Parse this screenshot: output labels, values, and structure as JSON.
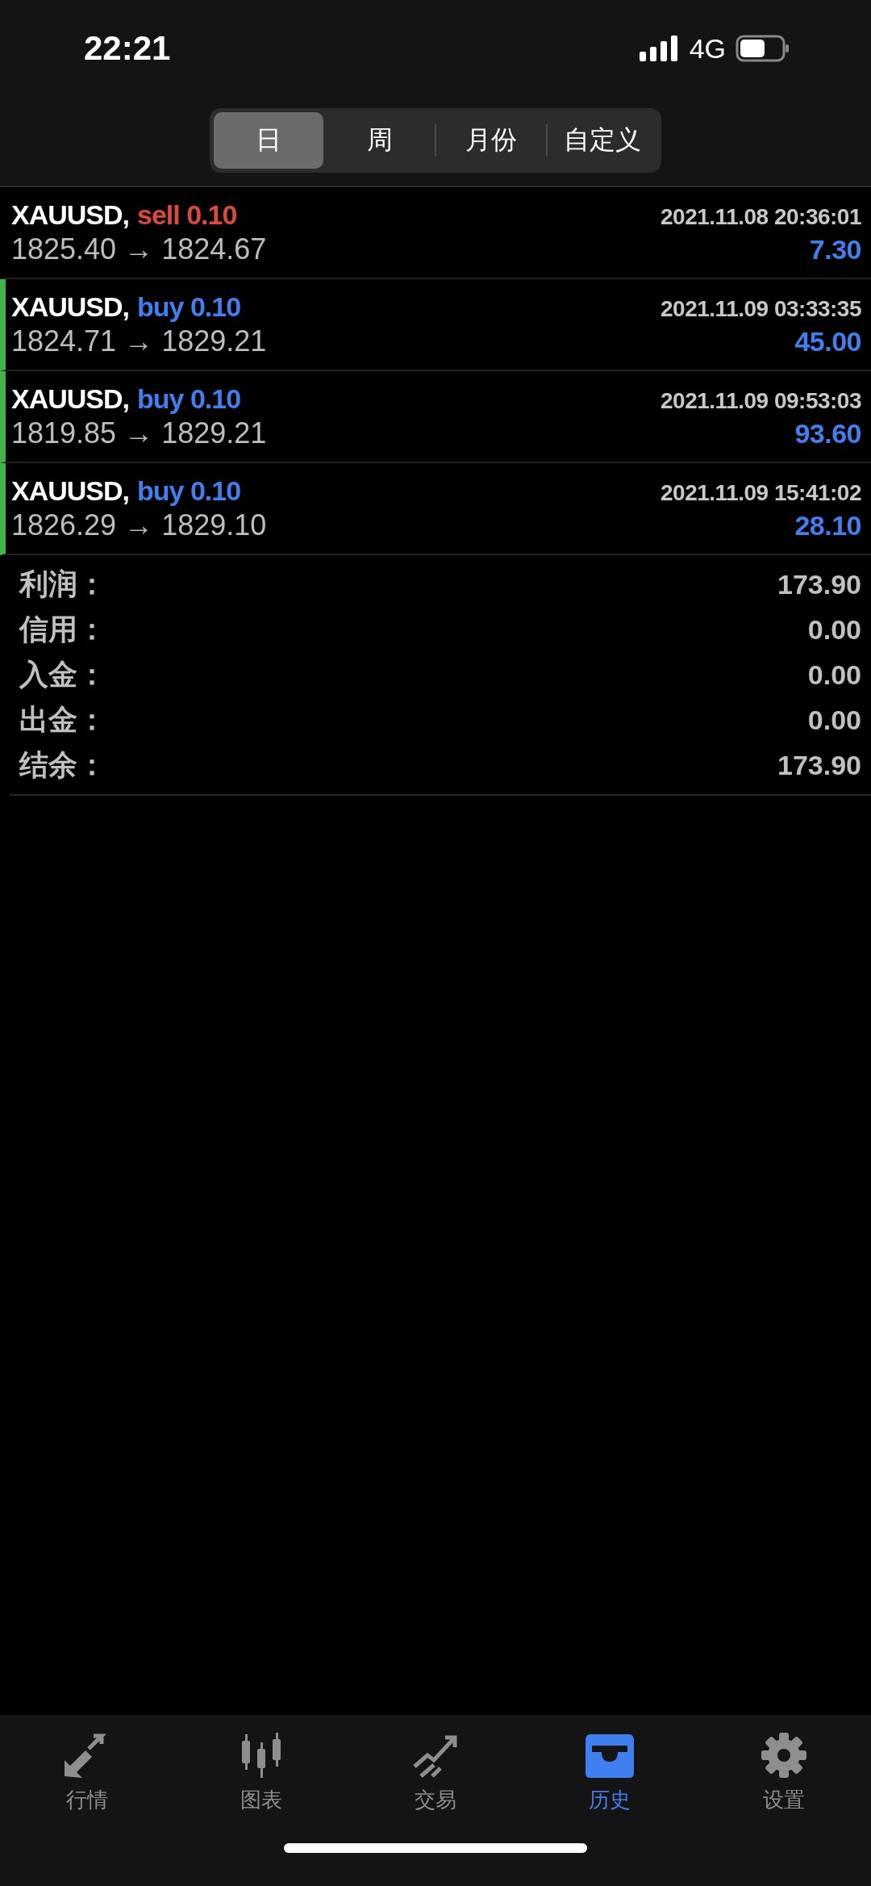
{
  "status_bar": {
    "time": "22:21",
    "network": "4G"
  },
  "tabs": [
    {
      "label": "日",
      "selected": true
    },
    {
      "label": "周",
      "selected": false
    },
    {
      "label": "月份",
      "selected": false
    },
    {
      "label": "自定义",
      "selected": false
    }
  ],
  "deals": [
    {
      "symbol": "XAUUSD,",
      "kind": "sell",
      "order": "sell 0.10",
      "time": "2021.11.08 20:36:01",
      "prices": "1825.40 → 1824.67",
      "profit": "7.30",
      "marked": false
    },
    {
      "symbol": "XAUUSD,",
      "kind": "buy",
      "order": "buy 0.10",
      "time": "2021.11.09 03:33:35",
      "prices": "1824.71 → 1829.21",
      "profit": "45.00",
      "marked": true
    },
    {
      "symbol": "XAUUSD,",
      "kind": "buy",
      "order": "buy 0.10",
      "time": "2021.11.09 09:53:03",
      "prices": "1819.85 → 1829.21",
      "profit": "93.60",
      "marked": true
    },
    {
      "symbol": "XAUUSD,",
      "kind": "buy",
      "order": "buy 0.10",
      "time": "2021.11.09 15:41:02",
      "prices": "1826.29 → 1829.10",
      "profit": "28.10",
      "marked": true
    }
  ],
  "summary": [
    {
      "label": "利润：",
      "value": "173.90"
    },
    {
      "label": "信用：",
      "value": "0.00"
    },
    {
      "label": "入金：",
      "value": "0.00"
    },
    {
      "label": "出金：",
      "value": "0.00"
    },
    {
      "label": "结余：",
      "value": "173.90"
    }
  ],
  "tab_bar": [
    {
      "kind": "quotes",
      "label": "行情",
      "selected": false
    },
    {
      "kind": "chart",
      "label": "图表",
      "selected": false
    },
    {
      "kind": "trade",
      "label": "交易",
      "selected": false
    },
    {
      "kind": "history",
      "label": "历史",
      "selected": true
    },
    {
      "kind": "settings",
      "label": "设置",
      "selected": false
    }
  ]
}
